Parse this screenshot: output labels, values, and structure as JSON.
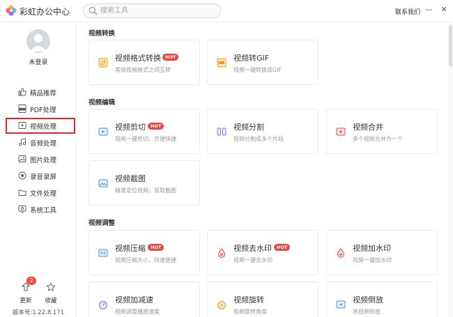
{
  "app": {
    "title": "彩虹办公中心"
  },
  "search": {
    "placeholder": "搜索工具"
  },
  "header": {
    "contact": "联系我们",
    "minimize": "—",
    "close": "✕"
  },
  "user": {
    "login_label": "未登录"
  },
  "sidebar": {
    "items": [
      {
        "label": "精品推荐",
        "icon": "thumbs-up-icon"
      },
      {
        "label": "PDF处理",
        "icon": "pdf-icon"
      },
      {
        "label": "视频处理",
        "icon": "video-icon",
        "active": true
      },
      {
        "label": "音频处理",
        "icon": "music-note-icon"
      },
      {
        "label": "图片处理",
        "icon": "image-icon"
      },
      {
        "label": "录音录屏",
        "icon": "record-icon"
      },
      {
        "label": "文件处理",
        "icon": "folder-icon"
      },
      {
        "label": "系统工具",
        "icon": "system-tool-icon"
      }
    ],
    "update_label": "更新",
    "update_badge": "2",
    "favorite_label": "收藏",
    "version": "版本号:1.22.8.171"
  },
  "sections": {
    "convert": {
      "title": "视频转换"
    },
    "edit": {
      "title": "视频编辑"
    },
    "adjust": {
      "title": "视频调整"
    }
  },
  "cards": {
    "format_convert": {
      "title": "视频格式转换",
      "desc": "常规视频格式之间互转",
      "hot": "HOT"
    },
    "to_gif": {
      "title": "视频转GIF",
      "desc": "视频一键转换成GIF"
    },
    "cut": {
      "title": "视频剪切",
      "desc": "视频一键剪切，方便快捷",
      "hot": "HOT"
    },
    "split": {
      "title": "视频分割",
      "desc": "视频分割成多个片段"
    },
    "merge": {
      "title": "视频合并",
      "desc": "多个视频合并为一个"
    },
    "screenshot": {
      "title": "视频截图",
      "desc": "精准定位视频，获取截图"
    },
    "compress": {
      "title": "视频压缩",
      "desc": "视频压缩大小，快速便捷",
      "hot": "HOT"
    },
    "remove_watermark": {
      "title": "视频去水印",
      "desc": "视频一键去水印",
      "hot": "HOT"
    },
    "add_watermark": {
      "title": "视频加水印",
      "desc": "视频一键加水印"
    },
    "speed": {
      "title": "视频加减速",
      "desc": "视频调整播放速度"
    },
    "rotate": {
      "title": "视频旋转",
      "desc": "视频旋转角度"
    },
    "reverse": {
      "title": "视频倒放",
      "desc": "将视频倒放"
    }
  },
  "colors": {
    "accent_orange": "#f39a1c",
    "accent_purple": "#8b6ff0",
    "accent_red": "#e94545",
    "accent_blue": "#4a8ff0",
    "highlight_border": "#e8262a"
  }
}
